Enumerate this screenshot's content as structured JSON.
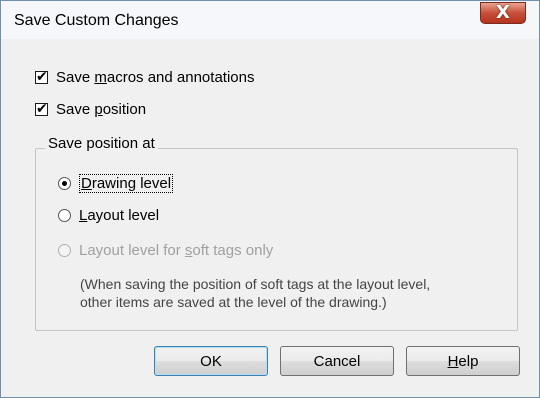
{
  "window": {
    "title": "Save Custom Changes",
    "close_glyph": "X"
  },
  "options": {
    "save_macros": {
      "pre": "Save ",
      "accel": "m",
      "post": "acros and annotations",
      "checked": true
    },
    "save_position": {
      "pre": "Save ",
      "accel": "p",
      "post": "osition",
      "checked": true
    }
  },
  "group": {
    "legend": "Save position at",
    "drawing_level": {
      "pre": "",
      "accel": "D",
      "post": "rawing level",
      "selected": true
    },
    "layout_level": {
      "pre": "",
      "accel": "L",
      "post": "ayout level",
      "selected": false
    },
    "soft_tags": {
      "pre": "Layout level for ",
      "accel": "s",
      "post": "oft tags only",
      "enabled": false
    },
    "note_line1": "(When saving the position of soft tags at the layout level,",
    "note_line2": "other items are saved at the level of the drawing.)"
  },
  "buttons": {
    "ok": "OK",
    "cancel": "Cancel",
    "help_accel": "H",
    "help_rest": "elp"
  }
}
